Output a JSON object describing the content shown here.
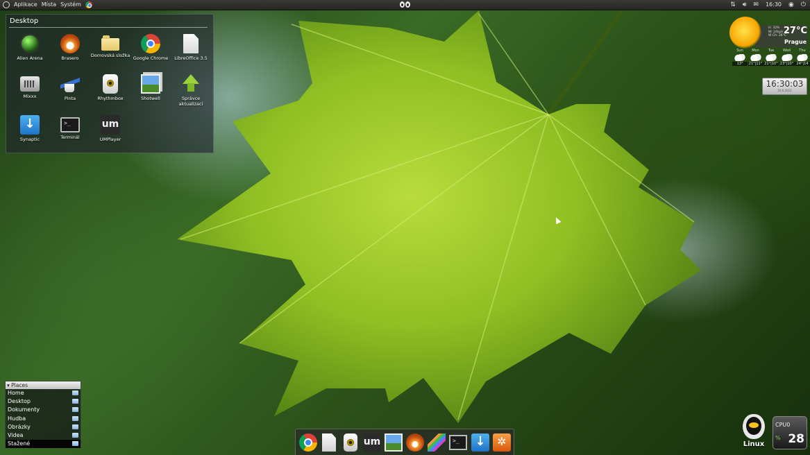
{
  "top_panel": {
    "menus": [
      "Aplikace",
      "Místa",
      "Systém"
    ],
    "clock": "16:30"
  },
  "desktop_widget": {
    "title": "Desktop",
    "icons": [
      {
        "label": "Alien Arena",
        "icon": "alien-arena-icon"
      },
      {
        "label": "Brasero",
        "icon": "brasero-icon"
      },
      {
        "label": "Domovská složka",
        "icon": "home-folder-icon"
      },
      {
        "label": "Google Chrome",
        "icon": "chrome-icon"
      },
      {
        "label": "LibreOffice 3.5",
        "icon": "libreoffice-icon"
      },
      {
        "label": "Mixxx",
        "icon": "mixxx-icon"
      },
      {
        "label": "Pinta",
        "icon": "pinta-icon"
      },
      {
        "label": "Rhythmbox",
        "icon": "rhythmbox-icon"
      },
      {
        "label": "Shotwell",
        "icon": "shotwell-icon"
      },
      {
        "label": "Správce aktualizací",
        "icon": "update-manager-icon"
      },
      {
        "label": "Synaptic",
        "icon": "synaptic-icon"
      },
      {
        "label": "Terminál",
        "icon": "terminal-icon"
      },
      {
        "label": "UMPlayer",
        "icon": "umplayer-icon"
      }
    ]
  },
  "weather": {
    "temperature": "27°C",
    "city": "Prague",
    "details": [
      "H: 32%",
      "W: 24kph",
      "W Ch: 26°C"
    ],
    "forecast": [
      {
        "day": "Sun",
        "temps": "13°"
      },
      {
        "day": "Mon",
        "temps": "21°|11°"
      },
      {
        "day": "Tue",
        "temps": "21°|10°"
      },
      {
        "day": "Wed",
        "temps": "23°|10°"
      },
      {
        "day": "Thu",
        "temps": "24°|14"
      }
    ]
  },
  "clock_widget": {
    "time": "16:30:03",
    "date": "24.6.2012"
  },
  "places": {
    "header": "▾ Places",
    "items": [
      "Home",
      "Desktop",
      "Dokumenty",
      "Hudba",
      "Obrázky",
      "Videa",
      "Stažené"
    ],
    "selected": "Stažené"
  },
  "dock": {
    "items": [
      "chrome-icon",
      "libreoffice-icon",
      "rhythmbox-icon",
      "umplayer-icon",
      "shotwell-icon",
      "brasero-icon",
      "pinta-icon",
      "terminal-icon",
      "synaptic-icon",
      "update-manager-icon"
    ]
  },
  "system_monitor": {
    "linux_label": "Linux",
    "cpu_label": "CPU0",
    "cpu_percent_sign": "%",
    "cpu_value": "28"
  }
}
